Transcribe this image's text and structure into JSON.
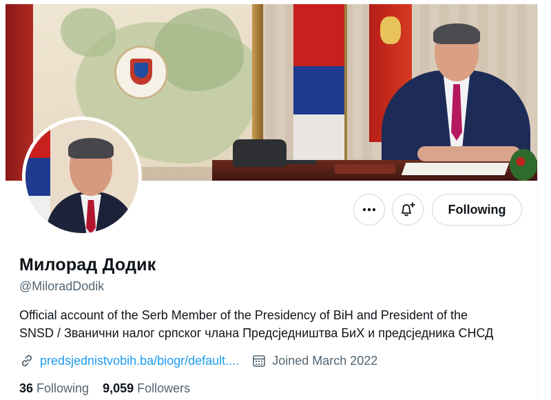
{
  "profile": {
    "name": "Милорад Додик",
    "handle": "@MiloradDodik",
    "bio_line1": "Official account of the Serb Member of the Presidency of BiH and President of the",
    "bio_line2": "SNSD / Званични налог српског члана Предсједништва БиХ и предсједника СНСД",
    "website": "predsjednistvobih.ba/biogr/default....",
    "joined": "Joined March 2022"
  },
  "actions": {
    "more_icon": "more-horizontal-icon",
    "bell_icon": "bell-plus-icon",
    "follow_label": "Following"
  },
  "stats": {
    "following_count": "36",
    "following_label": "Following",
    "followers_count": "9,059",
    "followers_label": "Followers"
  },
  "colors": {
    "accent": "#1d9bf0",
    "secondary_text": "#536471",
    "primary_text": "#0f1419",
    "border": "#cfd9de"
  }
}
